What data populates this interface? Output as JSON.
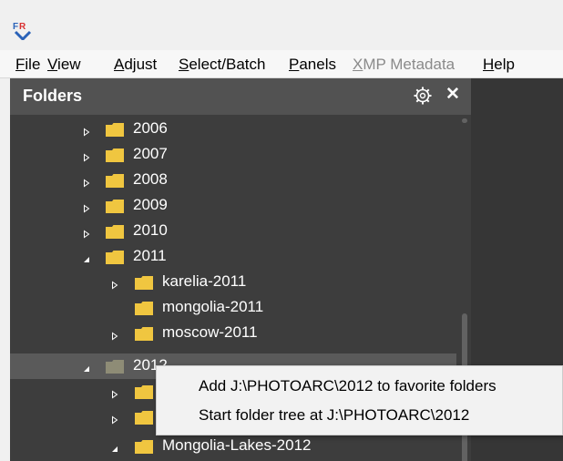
{
  "menu": {
    "file": "File",
    "view": "View",
    "adjust": "Adjust",
    "select_batch": "Select/Batch",
    "panels": "Panels",
    "xmp_metadata": "XMP Metadata",
    "help": "Help"
  },
  "panel": {
    "title": "Folders",
    "settings_icon": "gear-icon",
    "close_label": "✕"
  },
  "tree": {
    "rows": [
      {
        "label": "2006",
        "expander": "collapsed"
      },
      {
        "label": "2007",
        "expander": "collapsed"
      },
      {
        "label": "2008",
        "expander": "collapsed"
      },
      {
        "label": "2009",
        "expander": "collapsed"
      },
      {
        "label": "2010",
        "expander": "collapsed"
      },
      {
        "label": "2011",
        "expander": "expanded"
      },
      {
        "label": "karelia-2011",
        "expander": "collapsed"
      },
      {
        "label": "mongolia-2011",
        "expander": "none"
      },
      {
        "label": "moscow-2011",
        "expander": "collapsed"
      },
      {
        "label": "2012",
        "expander": "expanded",
        "selected": true
      },
      {
        "label": "",
        "expander": "collapsed"
      },
      {
        "label": "",
        "expander": "collapsed"
      },
      {
        "label": "Mongolia-Lakes-2012",
        "expander": "expanded"
      }
    ]
  },
  "context_menu": {
    "items": [
      {
        "label": "Add J:\\PHOTOARC\\2012 to favorite folders"
      },
      {
        "label": "Start folder tree at J:\\PHOTOARC\\2012"
      }
    ]
  },
  "colors": {
    "panel_bg": "#3d3d3d",
    "panel_header_bg": "#525252",
    "folder": "#f0c640",
    "selected_row": "#5a5a5a",
    "selected_folder": "#8e8c76"
  }
}
